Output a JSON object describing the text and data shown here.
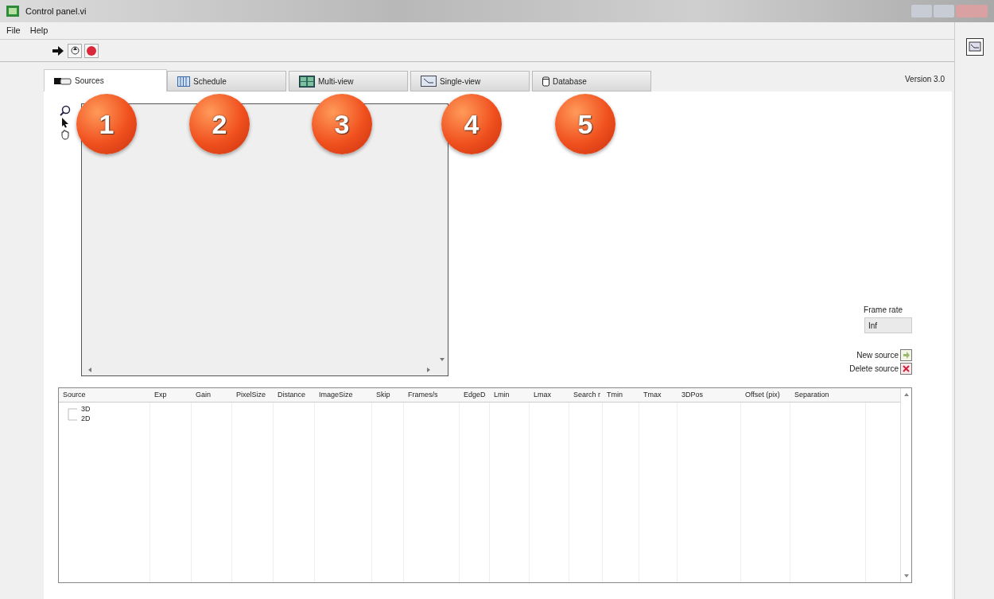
{
  "window": {
    "title": "Control panel.vi"
  },
  "menu": [
    "File",
    "Help"
  ],
  "toolbar": [
    {
      "kind": "run"
    },
    {
      "kind": "continuous"
    },
    {
      "kind": "stop"
    }
  ],
  "tabs": [
    {
      "label": "Sources",
      "selected": true
    },
    {
      "label": "Schedule",
      "selected": false
    },
    {
      "label": "Multi-view",
      "selected": false
    },
    {
      "label": "Single-view",
      "selected": false
    },
    {
      "label": "Database",
      "selected": false
    }
  ],
  "version": "Version 3.0",
  "callouts": [
    "1",
    "2",
    "3",
    "4",
    "5"
  ],
  "frame_rate": {
    "label": "Frame rate",
    "value": "Inf"
  },
  "actions": [
    {
      "kind": "new",
      "label": "New source"
    },
    {
      "kind": "delete",
      "label": "Delete source"
    }
  ],
  "table": {
    "columns": [
      "Source",
      "Exp",
      "Gain",
      "PixelSize",
      "Distance",
      "ImageSize",
      "Skip",
      "Frames/s",
      "EdgeD",
      "Lmin",
      "Lmax",
      "Search r",
      "Tmin",
      "Tmax",
      "3DPos",
      "Offset (pix)",
      "Separation"
    ],
    "rows": [
      {
        "source": "3D"
      },
      {
        "source": "2D"
      }
    ]
  }
}
